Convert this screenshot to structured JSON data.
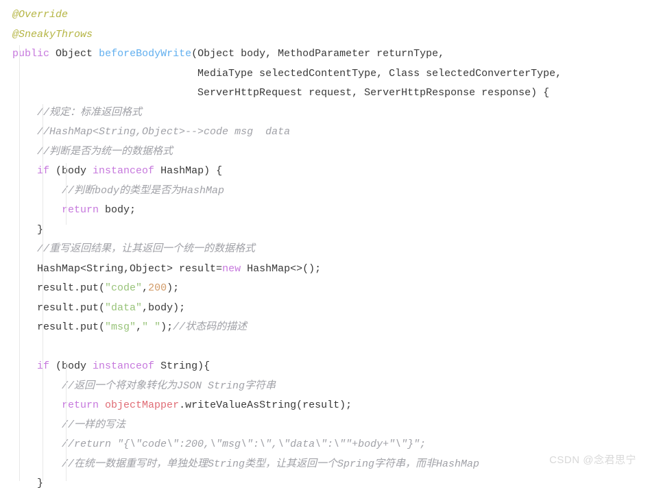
{
  "code": {
    "l1": "@Override",
    "l2": "@SneakyThrows",
    "l3_kw": "public",
    "l3_type1": "Object",
    "l3_method": "beforeBodyWrite",
    "l3_rest": "(Object body, MethodParameter returnType,",
    "l4": "MediaType selectedContentType, Class selectedConverterType,",
    "l5": "ServerHttpRequest request, ServerHttpResponse response) {",
    "l6": "//规定：标准返回格式",
    "l7": "//HashMap<String,Object>-->code msg  data",
    "l8": "//判断是否为统一的数据格式",
    "l9_if": "if",
    "l9_body": " (body ",
    "l9_inst": "instanceof",
    "l9_rest": " HashMap) {",
    "l10": "//判断body的类型是否为HashMap",
    "l11_ret": "return",
    "l11_rest": " body;",
    "l12": "}",
    "l13": "//重写返回结果，让其返回一个统一的数据格式",
    "l14_a": "HashMap<String,Object> result=",
    "l14_new": "new",
    "l14_b": " HashMap<>();",
    "l15_a": "result.put(",
    "l15_s": "\"code\"",
    "l15_b": ",",
    "l15_n": "200",
    "l15_c": ");",
    "l16_a": "result.put(",
    "l16_s": "\"data\"",
    "l16_b": ",body);",
    "l17_a": "result.put(",
    "l17_s": "\"msg\"",
    "l17_b": ",",
    "l17_s2": "\" \"",
    "l17_c": ");",
    "l17_cm": "//状态码的描述",
    "l18": "",
    "l19_if": "if",
    "l19_body": " (body ",
    "l19_inst": "instanceof",
    "l19_rest": " String){",
    "l20": "//返回一个将对象转化为JSON String字符串",
    "l21_ret": "return",
    "l21_sp": " ",
    "l21_obj": "objectMapper",
    "l21_rest": ".writeValueAsString(result);",
    "l22": "//一样的写法",
    "l23": "//return \"{\\\"code\\\":200,\\\"msg\\\":\\\",\\\"data\\\":\\\"\"+body+\"\\\"}\";",
    "l24": "//在统一数据重写时，单独处理String类型，让其返回一个Spring字符串，而非HashMap",
    "l25": "}"
  },
  "watermark": "CSDN @念君思宁"
}
